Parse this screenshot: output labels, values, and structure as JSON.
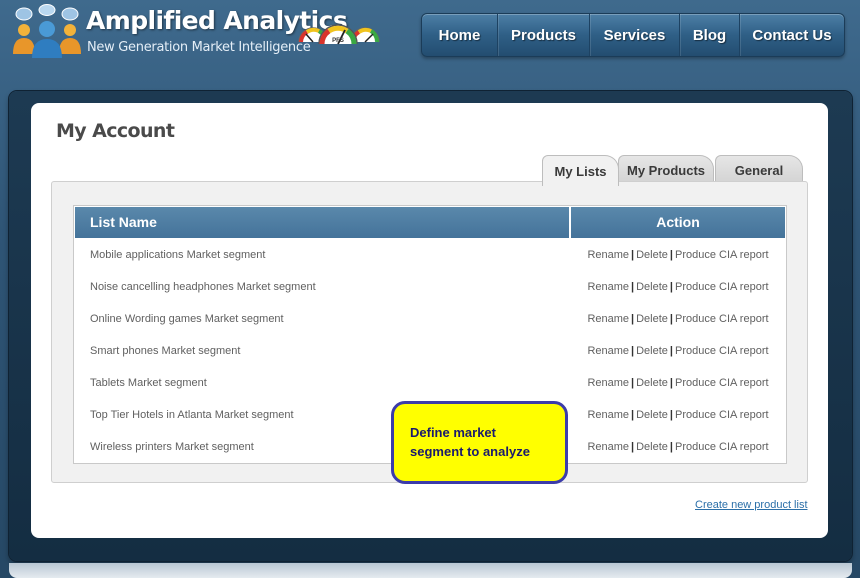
{
  "brand": {
    "title": "Amplified Analytics",
    "tagline": "New Generation Market Intelligence",
    "gauge_label": "PFS"
  },
  "nav": {
    "items": [
      "Home",
      "Products",
      "Services",
      "Blog",
      "Contact Us"
    ]
  },
  "page": {
    "title": "My Account"
  },
  "tabs": [
    "My Lists",
    "My Products",
    "General"
  ],
  "table": {
    "headers": {
      "name": "List Name",
      "action": "Action"
    },
    "rows": [
      "Mobile applications Market segment",
      "Noise cancelling headphones Market segment",
      "Online Wording games Market segment",
      "Smart phones Market segment",
      "Tablets Market segment",
      "Top Tier Hotels in Atlanta Market segment",
      "Wireless printers Market segment"
    ],
    "actions": {
      "rename": "Rename",
      "delete": "Delete",
      "produce": "Produce CIA report",
      "separator": "|"
    }
  },
  "create_link": "Create new product list",
  "callout": {
    "line1": "Define market",
    "line2": "segment to analyze"
  },
  "colors": {
    "header_bg": "#3f6a8d",
    "table_header": "#4f7ea3",
    "callout_fill": "#ffff00",
    "callout_border": "#3c3caa",
    "link": "#2b6fa8"
  }
}
